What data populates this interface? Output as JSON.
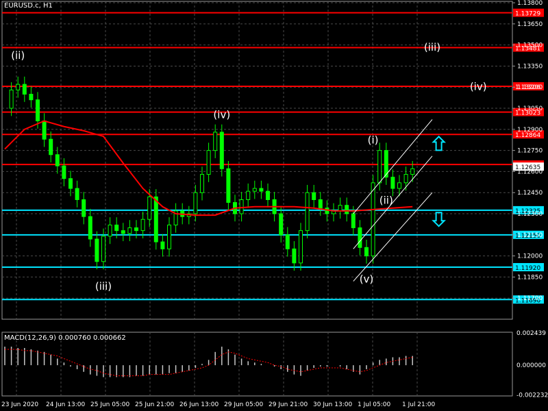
{
  "title": "EURUSD.c, H1",
  "macd_label": "MACD(12,26,9) 0.000760 0.000662",
  "colors": {
    "background": "#000000",
    "grid": "#4a4a4a",
    "candle": "#00ff00",
    "ma": "#ff0000",
    "resistance": "#ff0000",
    "support": "#00e5ff",
    "channel": "#ffffff",
    "arrow": "#00e5ff",
    "macd_hist": "#c8c8c8",
    "macd_signal": "#ff0000",
    "axis_text": "#ffffff"
  },
  "chart_data": {
    "type": "candlestick",
    "title": "EURUSD.c, H1",
    "timeframe": "H1",
    "ylim": [
      1.1155,
      1.1381
    ],
    "y_ticks": [
      1.138,
      1.1365,
      1.135,
      1.1335,
      1.132,
      1.1305,
      1.129,
      1.1275,
      1.126,
      1.1245,
      1.123,
      1.1215,
      1.12,
      1.1185,
      1.117
    ],
    "x_ticks": [
      "23 Jun 2020",
      "24 Jun 13:00",
      "25 Jun 05:00",
      "25 Jun 21:00",
      "26 Jun 13:00",
      "29 Jun 05:00",
      "29 Jun 21:00",
      "30 Jun 13:00",
      "1 Jul 05:00",
      "1 Jul 21:00"
    ],
    "price_path": [
      [
        0,
        1.1305
      ],
      [
        1,
        1.1318
      ],
      [
        2,
        1.1322
      ],
      [
        3,
        1.1315
      ],
      [
        4,
        1.1311
      ],
      [
        5,
        1.1296
      ],
      [
        6,
        1.1283
      ],
      [
        7,
        1.1272
      ],
      [
        8,
        1.1264
      ],
      [
        9,
        1.1255
      ],
      [
        10,
        1.1248
      ],
      [
        11,
        1.124
      ],
      [
        12,
        1.1228
      ],
      [
        13,
        1.1212
      ],
      [
        14,
        1.1196
      ],
      [
        15,
        1.1214
      ],
      [
        16,
        1.1222
      ],
      [
        17,
        1.1218
      ],
      [
        18,
        1.1216
      ],
      [
        19,
        1.122
      ],
      [
        20,
        1.1218
      ],
      [
        21,
        1.1226
      ],
      [
        22,
        1.1242
      ],
      [
        23,
        1.121
      ],
      [
        24,
        1.1205
      ],
      [
        25,
        1.1222
      ],
      [
        26,
        1.1232
      ],
      [
        27,
        1.1228
      ],
      [
        28,
        1.123
      ],
      [
        29,
        1.1245
      ],
      [
        30,
        1.1258
      ],
      [
        31,
        1.1275
      ],
      [
        32,
        1.1288
      ],
      [
        33,
        1.1262
      ],
      [
        34,
        1.1238
      ],
      [
        35,
        1.123
      ],
      [
        36,
        1.124
      ],
      [
        37,
        1.1246
      ],
      [
        38,
        1.1248
      ],
      [
        39,
        1.1246
      ],
      [
        40,
        1.124
      ],
      [
        41,
        1.123
      ],
      [
        42,
        1.1215
      ],
      [
        43,
        1.1205
      ],
      [
        44,
        1.1195
      ],
      [
        45,
        1.1218
      ],
      [
        46,
        1.1245
      ],
      [
        47,
        1.124
      ],
      [
        48,
        1.1234
      ],
      [
        49,
        1.123
      ],
      [
        50,
        1.1232
      ],
      [
        51,
        1.1236
      ],
      [
        52,
        1.123
      ],
      [
        53,
        1.122
      ],
      [
        54,
        1.1206
      ],
      [
        55,
        1.12
      ],
      [
        56,
        1.1252
      ],
      [
        57,
        1.1275
      ],
      [
        58,
        1.1256
      ],
      [
        59,
        1.1248
      ],
      [
        60,
        1.1252
      ],
      [
        61,
        1.1258
      ],
      [
        62,
        1.1262
      ]
    ],
    "moving_average": [
      [
        0,
        1.1276
      ],
      [
        3,
        1.129
      ],
      [
        6,
        1.1296
      ],
      [
        9,
        1.1292
      ],
      [
        12,
        1.1289
      ],
      [
        15,
        1.1285
      ],
      [
        18,
        1.1266
      ],
      [
        21,
        1.1248
      ],
      [
        24,
        1.1235
      ],
      [
        26,
        1.123
      ],
      [
        29,
        1.1229
      ],
      [
        32,
        1.1229
      ],
      [
        35,
        1.1234
      ],
      [
        38,
        1.1235
      ],
      [
        41,
        1.1235
      ],
      [
        44,
        1.1235
      ],
      [
        47,
        1.1234
      ],
      [
        50,
        1.1232
      ],
      [
        53,
        1.1232
      ],
      [
        56,
        1.1233
      ],
      [
        59,
        1.1234
      ],
      [
        62,
        1.1235
      ]
    ],
    "horizontal_levels": [
      {
        "value": 1.13729,
        "label": "1.13729",
        "kind": "resistance"
      },
      {
        "value": 1.13481,
        "label": "1.13481",
        "kind": "resistance"
      },
      {
        "value": 1.13206,
        "label": "1.13206",
        "kind": "resistance"
      },
      {
        "value": 1.13023,
        "label": "1.13023",
        "kind": "resistance"
      },
      {
        "value": 1.12864,
        "label": "1.12864",
        "kind": "resistance"
      },
      {
        "value": 1.1265,
        "label": "1.12650",
        "kind": "resistance"
      },
      {
        "value": 1.12325,
        "label": "1.12325",
        "kind": "support"
      },
      {
        "value": 1.1215,
        "label": "1.12150",
        "kind": "support"
      },
      {
        "value": 1.1192,
        "label": "1.11920",
        "kind": "support"
      },
      {
        "value": 1.1169,
        "label": "1.11690",
        "kind": "support"
      }
    ],
    "current_price": "1.12635",
    "wave_labels": [
      {
        "text": "(ii)",
        "index": 2,
        "price": 1.134
      },
      {
        "text": "(iii)",
        "index": 15,
        "price": 1.1176
      },
      {
        "text": "(iv)",
        "index": 33,
        "price": 1.1298
      },
      {
        "text": "(i)",
        "index": 56,
        "price": 1.128
      },
      {
        "text": "(ii)",
        "index": 58,
        "price": 1.1237
      },
      {
        "text": "(v)",
        "index": 55,
        "price": 1.1181
      },
      {
        "text": "(iii)",
        "index": 65,
        "price": 1.1346
      },
      {
        "text": "(iv)",
        "index": 72,
        "price": 1.1318
      }
    ],
    "channel_lines": [
      [
        [
          53,
          1.123
        ],
        [
          65,
          1.1297
        ]
      ],
      [
        [
          53,
          1.1205
        ],
        [
          65,
          1.1271
        ]
      ],
      [
        [
          53,
          1.1182
        ],
        [
          65,
          1.1245
        ]
      ]
    ],
    "arrows": [
      {
        "direction": "up",
        "index": 66,
        "price": 1.128
      },
      {
        "direction": "down",
        "index": 66,
        "price": 1.1226
      }
    ],
    "macd": {
      "label": "MACD(12,26,9) 0.000760 0.000662",
      "ylim": [
        -0.00232,
        0.00249
      ],
      "y_ticks": [
        "0.002439",
        "0.000000",
        "-0.002232"
      ],
      "histogram": [
        0.0014,
        0.0014,
        0.0013,
        0.0013,
        0.0012,
        0.0011,
        0.001,
        0.0008,
        0.0005,
        0.0002,
        -0.0001,
        -0.0003,
        -0.0005,
        -0.0007,
        -0.0008,
        -0.0009,
        -0.0009,
        -0.0009,
        -0.0009,
        -0.0009,
        -0.0008,
        -0.0008,
        -0.0007,
        -0.0007,
        -0.0007,
        -0.0006,
        -0.0006,
        -0.0005,
        -0.0004,
        -0.0002,
        0.0001,
        0.0004,
        0.001,
        0.0014,
        0.0012,
        0.0008,
        0.0005,
        0.0003,
        0.0002,
        0.0001,
        0.0,
        -0.0001,
        -0.0003,
        -0.0005,
        -0.0007,
        -0.0008,
        -0.0004,
        -0.0002,
        -0.0001,
        -0.0001,
        0.0,
        -0.0001,
        -0.0003,
        -0.0005,
        -0.0007,
        -0.0003,
        0.0002,
        0.0004,
        0.0005,
        0.0006,
        0.0006,
        0.0007,
        0.0007
      ],
      "signal": [
        0.0012,
        0.0012,
        0.0012,
        0.0011,
        0.0011,
        0.001,
        0.0009,
        0.0008,
        0.0007,
        0.0005,
        0.0003,
        0.0001,
        -0.0001,
        -0.0003,
        -0.0004,
        -0.0006,
        -0.0007,
        -0.0008,
        -0.0008,
        -0.0008,
        -0.0008,
        -0.0008,
        -0.0007,
        -0.0007,
        -0.0007,
        -0.0007,
        -0.0006,
        -0.0005,
        -0.0004,
        -0.0003,
        -0.0002,
        0.0,
        0.0004,
        0.0008,
        0.001,
        0.0009,
        0.0007,
        0.0005,
        0.0004,
        0.0003,
        0.0002,
        0.0,
        -0.0001,
        -0.0003,
        -0.0004,
        -0.0005,
        -0.0004,
        -0.0003,
        -0.0002,
        -0.0002,
        -0.0002,
        -0.0002,
        -0.0003,
        -0.0004,
        -0.0005,
        -0.0004,
        -0.0002,
        0.0,
        0.0002,
        0.0003,
        0.0004,
        0.0005,
        0.0006
      ]
    }
  }
}
